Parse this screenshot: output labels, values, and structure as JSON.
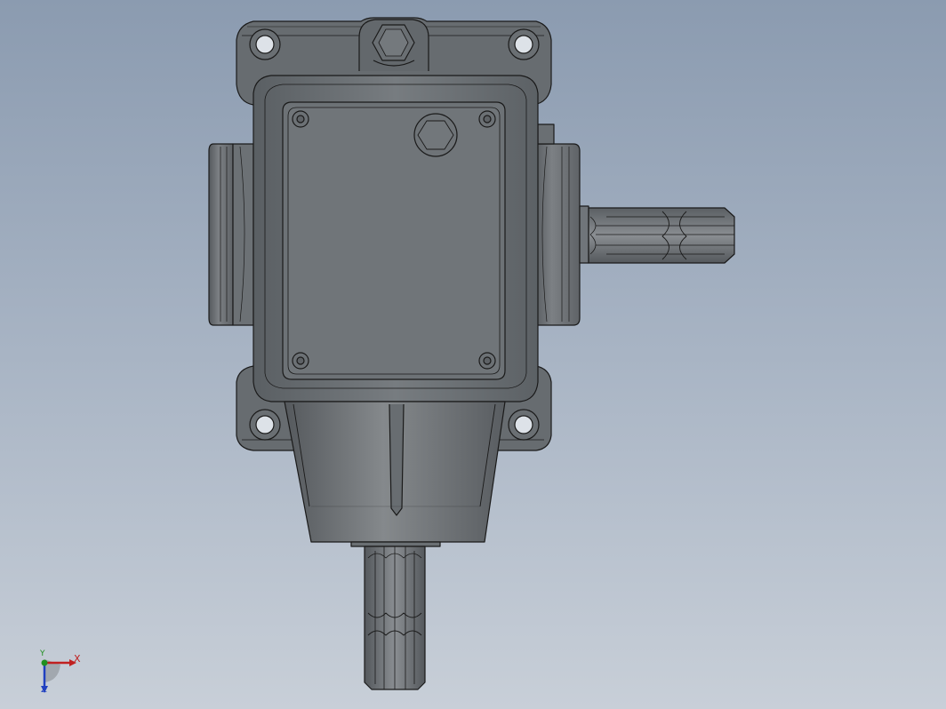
{
  "viewport": {
    "background_top": "#8b9bb0",
    "background_bottom": "#c8cfd8",
    "part_color": "#6e7377",
    "edge_color": "#1a1a1a"
  },
  "triad": {
    "x_label": "X",
    "y_label": "Y",
    "z_label": "Z",
    "x_color": "#c02020",
    "y_color": "#209020",
    "z_color": "#2040c0"
  }
}
